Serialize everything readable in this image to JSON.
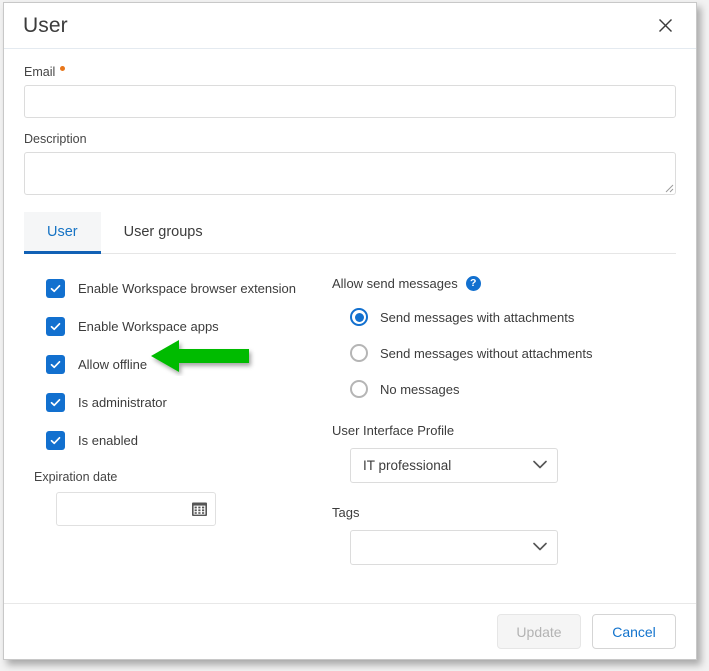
{
  "dialog": {
    "title": "User",
    "close_icon": "close-icon"
  },
  "form": {
    "email": {
      "label": "Email",
      "value": "",
      "placeholder": "",
      "required": true
    },
    "description": {
      "label": "Description",
      "value": "",
      "placeholder": ""
    }
  },
  "tabs": [
    {
      "label": "User",
      "active": true
    },
    {
      "label": "User groups",
      "active": false
    }
  ],
  "checkboxes": [
    {
      "label": "Enable Workspace browser extension",
      "checked": true
    },
    {
      "label": "Enable Workspace apps",
      "checked": true
    },
    {
      "label": "Allow offline",
      "checked": true
    },
    {
      "label": "Is administrator",
      "checked": true
    },
    {
      "label": "Is enabled",
      "checked": true
    }
  ],
  "expiration": {
    "label": "Expiration date",
    "value": "",
    "placeholder": "",
    "icon": "calendar-icon"
  },
  "allow_send_messages": {
    "label": "Allow send messages",
    "help_icon": "help-icon",
    "options": [
      {
        "label": "Send messages with attachments",
        "selected": true
      },
      {
        "label": "Send messages without attachments",
        "selected": false
      },
      {
        "label": "No messages",
        "selected": false
      }
    ]
  },
  "user_interface_profile": {
    "label": "User Interface Profile",
    "value": "IT professional"
  },
  "tags": {
    "label": "Tags",
    "value": ""
  },
  "footer": {
    "update_label": "Update",
    "cancel_label": "Cancel"
  },
  "annotation": {
    "arrow_color": "#00bb00",
    "points_at": "Allow offline"
  },
  "colors": {
    "accent": "#1270cf",
    "link": "#1273cd",
    "required_marker": "#e8761a",
    "tab_underline": "#1161b5"
  }
}
